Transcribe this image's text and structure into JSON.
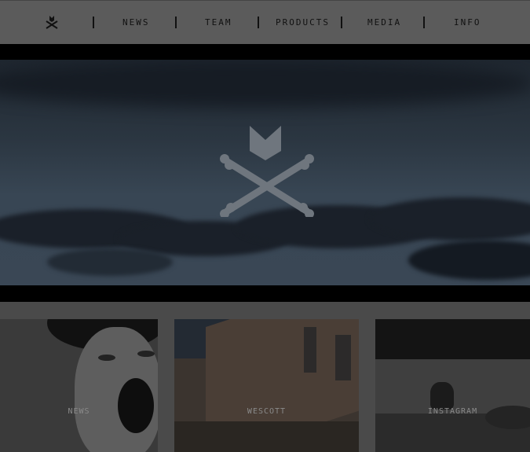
{
  "nav": {
    "items": [
      {
        "label": "NEWS"
      },
      {
        "label": "TEAM"
      },
      {
        "label": "PRODUCTS"
      },
      {
        "label": "MEDIA"
      },
      {
        "label": "INFO"
      }
    ]
  },
  "tiles": [
    {
      "label": "NEWS"
    },
    {
      "label": "WESCOTT"
    },
    {
      "label": "INSTAGRAM"
    }
  ],
  "colors": {
    "nav_bg": "#5b5b5b",
    "page_bg": "#4a4a4a",
    "hero_border": "#000000"
  }
}
